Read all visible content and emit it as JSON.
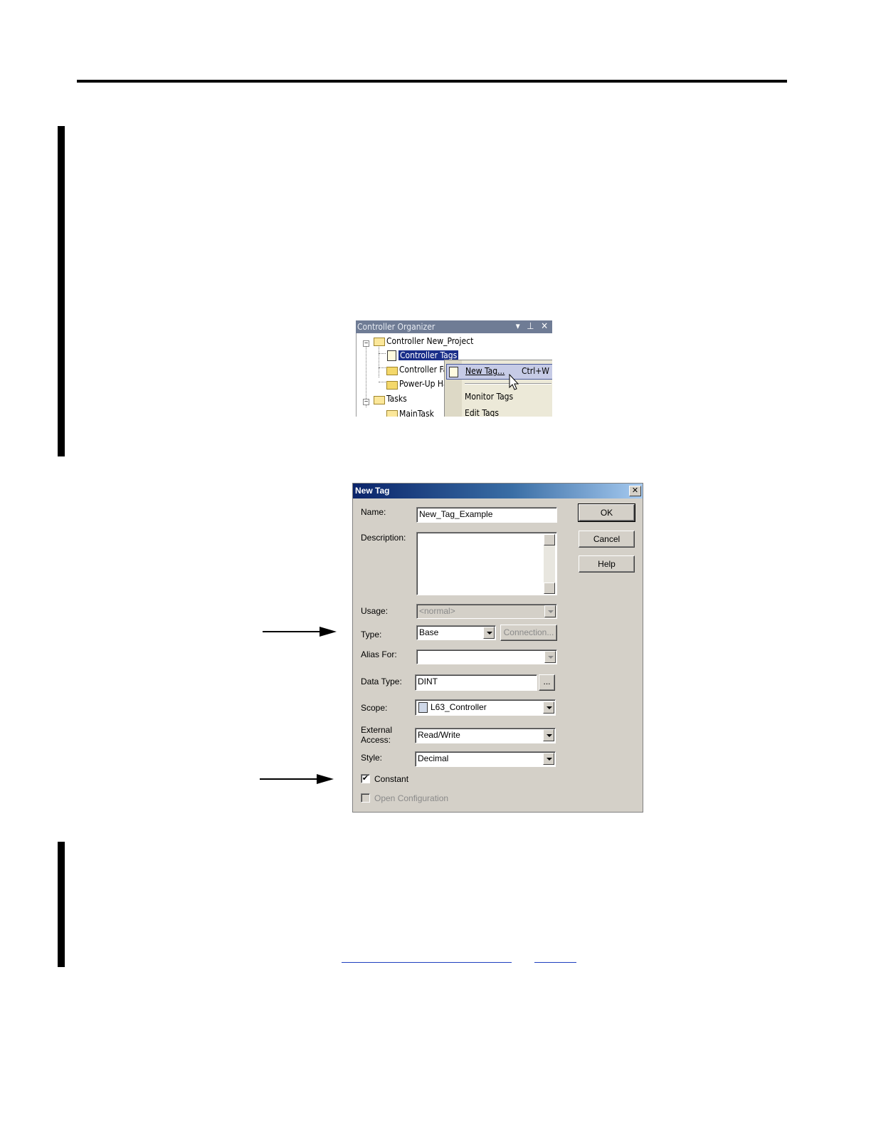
{
  "organizer": {
    "title": "Controller Organizer",
    "title_buttons": "▾ ⊥ ✕",
    "tree": {
      "controller": "Controller New_Project",
      "controller_tags": "Controller Tags",
      "controller_faults": "Controller Faults",
      "powerup_handler": "Power-Up Handler",
      "tasks": "Tasks",
      "main_task": "MainTask"
    },
    "context_menu": {
      "new_tag": "New Tag...",
      "new_tag_shortcut": "Ctrl+W",
      "monitor_tags": "Monitor Tags",
      "edit_tags": "Edit Tags"
    }
  },
  "dialog": {
    "title": "New Tag",
    "close_label": "✕",
    "labels": {
      "name": "Name:",
      "description": "Description:",
      "usage": "Usage:",
      "type": "Type:",
      "alias_for": "Alias For:",
      "data_type": "Data Type:",
      "scope": "Scope:",
      "external_access_1": "External",
      "external_access_2": "Access:",
      "style": "Style:"
    },
    "values": {
      "name": "New_Tag_Example",
      "description": "",
      "usage": "<normal>",
      "type": "Base",
      "alias_for": "",
      "data_type": "DINT",
      "scope": "L63_Controller",
      "external_access": "Read/Write",
      "style": "Decimal"
    },
    "buttons": {
      "ok": "OK",
      "cancel": "Cancel",
      "help": "Help",
      "connection": "Connection...",
      "browse": "..."
    },
    "checkboxes": {
      "constant": {
        "label": "Constant",
        "checked": true,
        "mark": "✔"
      },
      "open_configuration": {
        "label": "Open Configuration",
        "checked": false,
        "enabled": false
      }
    }
  }
}
